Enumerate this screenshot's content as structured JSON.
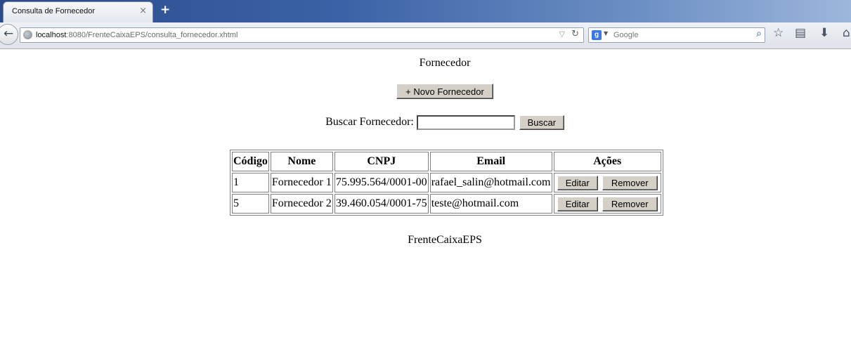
{
  "browser": {
    "tab_title": "Consulta de Fornecedor",
    "tab_close": "×",
    "new_tab": "+",
    "url_host": "localhost",
    "url_rest": ":8080/FrenteCaixaEPS/consulta_fornecedor.xhtml",
    "search_placeholder": "Google",
    "icons": [
      "back-arrow-icon",
      "globe-icon",
      "dropdown-icon",
      "reload-icon",
      "google-icon",
      "search-icon",
      "star-icon",
      "clipboard-icon",
      "download-icon",
      "home-icon"
    ]
  },
  "page": {
    "title": "Fornecedor",
    "novo_button": "+ Novo Fornecedor",
    "search_label": "Buscar Fornecedor:",
    "search_value": "",
    "search_button": "Buscar",
    "table": {
      "headers": [
        "Código",
        "Nome",
        "CNPJ",
        "Email",
        "Ações"
      ],
      "rows": [
        {
          "codigo": "1",
          "nome": "Fornecedor 1",
          "cnpj": "75.995.564/0001-00",
          "email": "rafael_salin@hotmail.com"
        },
        {
          "codigo": "5",
          "nome": "Fornecedor 2",
          "cnpj": "39.460.054/0001-75",
          "email": "teste@hotmail.com"
        }
      ],
      "edit_label": "Editar",
      "remove_label": "Remover"
    },
    "footer": "FrenteCaixaEPS"
  }
}
